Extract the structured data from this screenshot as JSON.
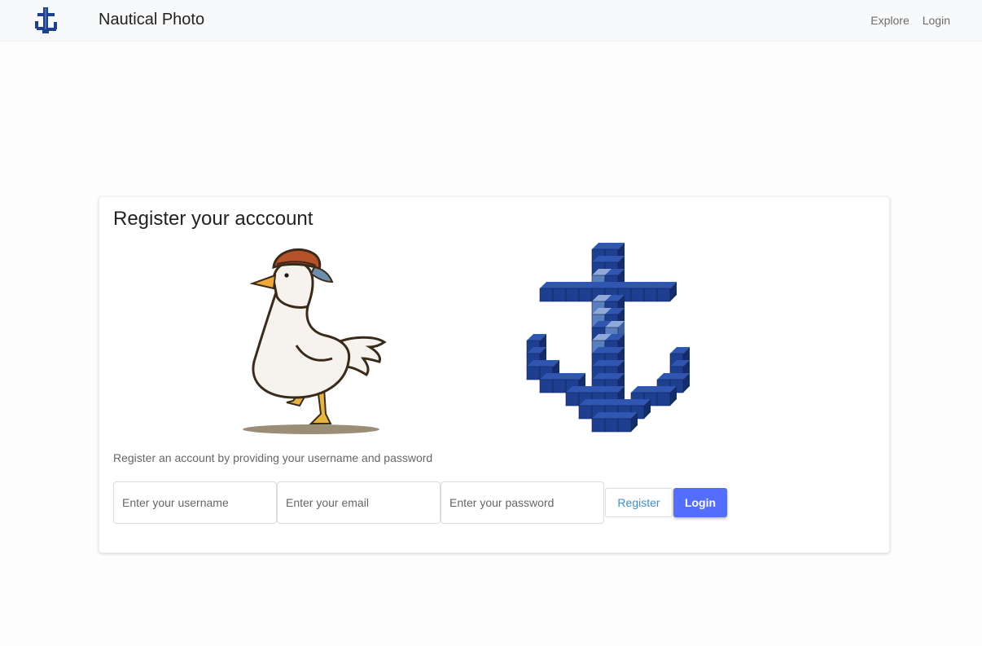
{
  "navbar": {
    "brand": "Nautical Photo",
    "logo_icon": "anchor-icon",
    "links": [
      "Explore",
      "Login"
    ]
  },
  "card": {
    "title": "Register your acccount",
    "description": "Register an account by providing your username and password",
    "images": [
      "duck-illustration",
      "pixel-anchor-illustration"
    ],
    "form": {
      "username_placeholder": "Enter your username",
      "email_placeholder": "Enter your email",
      "password_placeholder": "Enter your password",
      "register_label": "Register",
      "login_label": "Login"
    }
  },
  "colors": {
    "navbar_bg": "#f8f9fa",
    "primary": "#536dfe",
    "register_text": "#3f8ed8",
    "anchor_blue": "#1e3f8f"
  }
}
